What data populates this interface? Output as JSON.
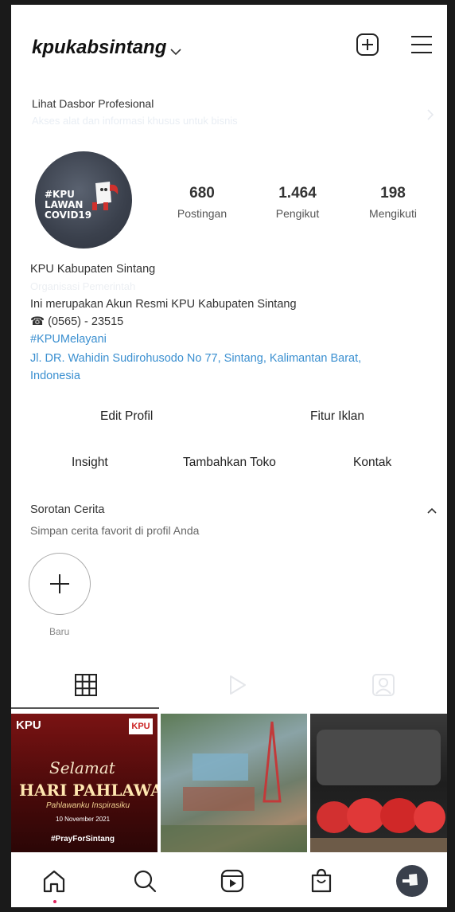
{
  "header": {
    "username": "kpukabsintang"
  },
  "dashboard": {
    "title": "Lihat Dasbor Profesional",
    "subtitle": "Akses alat dan informasi khusus untuk bisnis"
  },
  "profile": {
    "avatar_text": "#KPU LAWAN COVID19",
    "stats": [
      {
        "value": "680",
        "label": "Postingan"
      },
      {
        "value": "1.464",
        "label": "Pengikut"
      },
      {
        "value": "198",
        "label": "Mengikuti"
      }
    ],
    "name": "KPU Kabupaten Sintang",
    "category": "Organisasi Pemerintah",
    "bio": "Ini merupakan Akun Resmi KPU Kabupaten Sintang",
    "phone": "☎ (0565) - 23515",
    "hashtag": "#KPUMelayani",
    "address_line1": "Jl. DR. Wahidin Sudirohusodo No 77, Sintang, Kalimantan Barat,",
    "address_line2": "Indonesia"
  },
  "actions": {
    "edit_profile": "Edit Profil",
    "ad_tools": "Fitur Iklan",
    "insights": "Insight",
    "add_shop": "Tambahkan Toko",
    "contact": "Kontak"
  },
  "highlights": {
    "title": "Sorotan Cerita",
    "subtitle": "Simpan cerita favorit di profil Anda",
    "new_label": "Baru"
  },
  "posts": [
    {
      "badge": "KPU",
      "script_word": "Selamat",
      "headline": "HARI PAHLAWAN",
      "tagline": "Pahlawanku Inspirasiku",
      "date": "10 November 2021",
      "hashtag": "#PrayForSintang"
    }
  ],
  "colors": {
    "link": "#3a8fd0",
    "notification_dot": "#e0245e"
  }
}
